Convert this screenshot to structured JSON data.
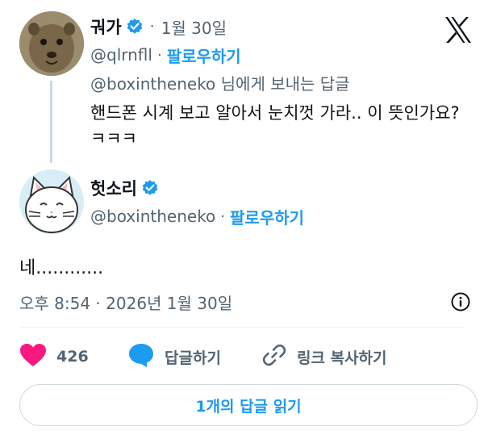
{
  "parent": {
    "display_name": "궈가",
    "date": "1월 30일",
    "handle": "@qlrnfll",
    "follow_label": "팔로우하기",
    "replying_to": "@boxintheneko 님에게 보내는 답글",
    "text": "핸드폰 시계 보고 알아서 눈치껏 가라.. 이 뜻인가요? ㅋㅋㅋ"
  },
  "main": {
    "display_name": "헛소리",
    "handle": "@boxintheneko",
    "follow_label": "팔로우하기",
    "text": "네............",
    "timestamp": "오후 8:54 · 2026년 1월 30일"
  },
  "actions": {
    "like_count": "426",
    "reply_label": "답글하기",
    "copy_link_label": "링크 복사하기"
  },
  "read_replies_label": "1개의 답글 읽기",
  "icons": {
    "verified": "verified-badge-icon",
    "x_logo": "x-logo-icon",
    "info": "info-icon",
    "heart": "heart-icon",
    "reply": "reply-bubble-icon",
    "link": "link-icon"
  },
  "colors": {
    "accent": "#1d9bf0",
    "heart": "#f91880",
    "secondary_text": "#536471"
  }
}
